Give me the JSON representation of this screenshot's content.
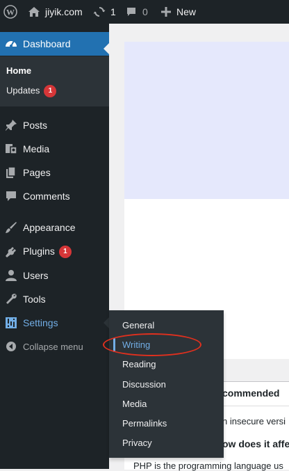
{
  "adminbar": {
    "site_name": "jiyik.com",
    "updates_count": "1",
    "comments_count": "0",
    "new_label": "New"
  },
  "sidebar": {
    "dashboard_label": "Dashboard",
    "home_label": "Home",
    "updates_label": "Updates",
    "updates_badge": "1",
    "items": [
      {
        "label": "Posts",
        "icon": "pin-icon"
      },
      {
        "label": "Media",
        "icon": "media-icon"
      },
      {
        "label": "Pages",
        "icon": "pages-icon"
      },
      {
        "label": "Comments",
        "icon": "comment-icon"
      },
      {
        "label": "Appearance",
        "icon": "brush-icon"
      },
      {
        "label": "Plugins",
        "icon": "plugin-icon",
        "badge": "1"
      },
      {
        "label": "Users",
        "icon": "user-icon"
      },
      {
        "label": "Tools",
        "icon": "wrench-icon"
      },
      {
        "label": "Settings",
        "icon": "settings-icon"
      },
      {
        "label": "Collapse menu",
        "icon": "collapse-icon"
      }
    ]
  },
  "flyout": {
    "items": [
      "General",
      "Writing",
      "Reading",
      "Discussion",
      "Media",
      "Permalinks",
      "Privacy"
    ],
    "active": "Writing"
  },
  "content": {
    "health_heading_partial": "commended",
    "health_line1_partial": "n insecure versi",
    "health_question_partial": "ow does it affe",
    "health_paragraph_partial": "PHP is the programming language us"
  },
  "colors": {
    "adminbar_bg": "#1d2327",
    "sidebar_bg": "#1d2327",
    "accent": "#2271b1",
    "active_text": "#72aee6",
    "badge": "#d63638",
    "annotation": "#e0301e"
  }
}
